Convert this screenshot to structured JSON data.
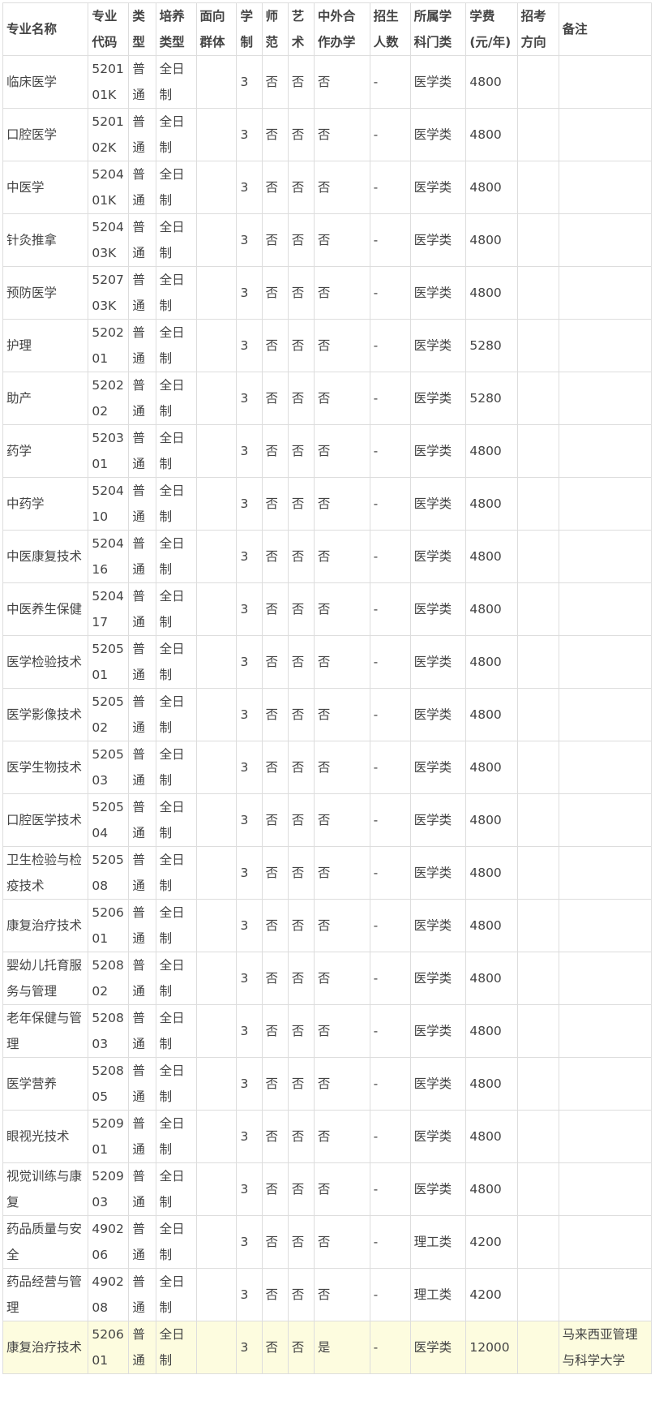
{
  "table": {
    "columns": [
      "专业名称",
      "专业代码",
      "类型",
      "培养类型",
      "面向群体",
      "学制",
      "师范",
      "艺术",
      "中外合作办学",
      "招生人数",
      "所属学科门类",
      "学费(元/年)",
      "招考方向",
      "备注"
    ],
    "rows": [
      [
        "临床医学",
        "520101K",
        "普通",
        "全日制",
        "",
        "3",
        "否",
        "否",
        "否",
        "-",
        "医学类",
        "4800",
        "",
        ""
      ],
      [
        "口腔医学",
        "520102K",
        "普通",
        "全日制",
        "",
        "3",
        "否",
        "否",
        "否",
        "-",
        "医学类",
        "4800",
        "",
        ""
      ],
      [
        "中医学",
        "520401K",
        "普通",
        "全日制",
        "",
        "3",
        "否",
        "否",
        "否",
        "-",
        "医学类",
        "4800",
        "",
        ""
      ],
      [
        "针灸推拿",
        "520403K",
        "普通",
        "全日制",
        "",
        "3",
        "否",
        "否",
        "否",
        "-",
        "医学类",
        "4800",
        "",
        ""
      ],
      [
        "预防医学",
        "520703K",
        "普通",
        "全日制",
        "",
        "3",
        "否",
        "否",
        "否",
        "-",
        "医学类",
        "4800",
        "",
        ""
      ],
      [
        "护理",
        "520201",
        "普通",
        "全日制",
        "",
        "3",
        "否",
        "否",
        "否",
        "-",
        "医学类",
        "5280",
        "",
        ""
      ],
      [
        "助产",
        "520202",
        "普通",
        "全日制",
        "",
        "3",
        "否",
        "否",
        "否",
        "-",
        "医学类",
        "5280",
        "",
        ""
      ],
      [
        "药学",
        "520301",
        "普通",
        "全日制",
        "",
        "3",
        "否",
        "否",
        "否",
        "-",
        "医学类",
        "4800",
        "",
        ""
      ],
      [
        "中药学",
        "520410",
        "普通",
        "全日制",
        "",
        "3",
        "否",
        "否",
        "否",
        "-",
        "医学类",
        "4800",
        "",
        ""
      ],
      [
        "中医康复技术",
        "520416",
        "普通",
        "全日制",
        "",
        "3",
        "否",
        "否",
        "否",
        "-",
        "医学类",
        "4800",
        "",
        ""
      ],
      [
        "中医养生保健",
        "520417",
        "普通",
        "全日制",
        "",
        "3",
        "否",
        "否",
        "否",
        "-",
        "医学类",
        "4800",
        "",
        ""
      ],
      [
        "医学检验技术",
        "520501",
        "普通",
        "全日制",
        "",
        "3",
        "否",
        "否",
        "否",
        "-",
        "医学类",
        "4800",
        "",
        ""
      ],
      [
        "医学影像技术",
        "520502",
        "普通",
        "全日制",
        "",
        "3",
        "否",
        "否",
        "否",
        "-",
        "医学类",
        "4800",
        "",
        ""
      ],
      [
        "医学生物技术",
        "520503",
        "普通",
        "全日制",
        "",
        "3",
        "否",
        "否",
        "否",
        "-",
        "医学类",
        "4800",
        "",
        ""
      ],
      [
        "口腔医学技术",
        "520504",
        "普通",
        "全日制",
        "",
        "3",
        "否",
        "否",
        "否",
        "-",
        "医学类",
        "4800",
        "",
        ""
      ],
      [
        "卫生检验与检疫技术",
        "520508",
        "普通",
        "全日制",
        "",
        "3",
        "否",
        "否",
        "否",
        "-",
        "医学类",
        "4800",
        "",
        ""
      ],
      [
        "康复治疗技术",
        "520601",
        "普通",
        "全日制",
        "",
        "3",
        "否",
        "否",
        "否",
        "-",
        "医学类",
        "4800",
        "",
        ""
      ],
      [
        "婴幼儿托育服务与管理",
        "520802",
        "普通",
        "全日制",
        "",
        "3",
        "否",
        "否",
        "否",
        "-",
        "医学类",
        "4800",
        "",
        ""
      ],
      [
        "老年保健与管理",
        "520803",
        "普通",
        "全日制",
        "",
        "3",
        "否",
        "否",
        "否",
        "-",
        "医学类",
        "4800",
        "",
        ""
      ],
      [
        "医学营养",
        "520805",
        "普通",
        "全日制",
        "",
        "3",
        "否",
        "否",
        "否",
        "-",
        "医学类",
        "4800",
        "",
        ""
      ],
      [
        "眼视光技术",
        "520901",
        "普通",
        "全日制",
        "",
        "3",
        "否",
        "否",
        "否",
        "-",
        "医学类",
        "4800",
        "",
        ""
      ],
      [
        "视觉训练与康复",
        "520903",
        "普通",
        "全日制",
        "",
        "3",
        "否",
        "否",
        "否",
        "-",
        "医学类",
        "4800",
        "",
        ""
      ],
      [
        "药品质量与安全",
        "490206",
        "普通",
        "全日制",
        "",
        "3",
        "否",
        "否",
        "否",
        "-",
        "理工类",
        "4200",
        "",
        ""
      ],
      [
        "药品经营与管理",
        "490208",
        "普通",
        "全日制",
        "",
        "3",
        "否",
        "否",
        "否",
        "-",
        "理工类",
        "4200",
        "",
        ""
      ],
      [
        "康复治疗技术",
        "520601",
        "普通",
        "全日制",
        "",
        "3",
        "否",
        "否",
        "是",
        "-",
        "医学类",
        "12000",
        "",
        "马来西亚管理与科学大学"
      ]
    ],
    "highlight_color": "#fdfcdf",
    "border_color": "#dddddd",
    "text_color": "#444444"
  }
}
